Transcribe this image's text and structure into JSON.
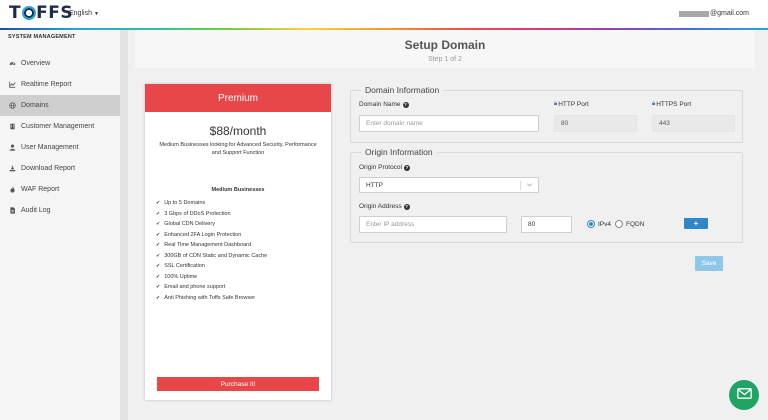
{
  "header": {
    "logo_text": "TOFFS",
    "language": "English",
    "user_email": "@gmail.com"
  },
  "sidebar": {
    "section_title": "SYSTEM MANAGEMENT",
    "items": [
      {
        "label": "Overview",
        "icon": "dashboard-icon"
      },
      {
        "label": "Realtime Report",
        "icon": "chart-icon"
      },
      {
        "label": "Domains",
        "icon": "globe-icon",
        "active": true
      },
      {
        "label": "Customer Management",
        "icon": "building-icon"
      },
      {
        "label": "User Management",
        "icon": "user-icon"
      },
      {
        "label": "Download Report",
        "icon": "download-icon"
      },
      {
        "label": "WAF Report",
        "icon": "fire-icon"
      },
      {
        "label": "Audit Log",
        "icon": "document-icon"
      }
    ]
  },
  "page": {
    "title": "Setup Domain",
    "step": "Step 1 of 2"
  },
  "plan": {
    "name": "Premium",
    "price": "$88/month",
    "description": "Medium Businesses looking for Advanced Security, Performance and Support Function",
    "subtitle": "Medium Businesses",
    "features": [
      "Up to 5 Domains",
      "3 Gbps of DDoS Protection",
      "Global CDN Delivery",
      "Enhanced 2FA Login Protection",
      "Real Time Management Dashboard",
      "300GB of CDN Static and Dynamic Cache",
      "SSL Certification",
      "100% Uptime",
      "Email and phone support",
      "Anti Phishing with Toffs Safe Browser"
    ],
    "purchase_label": "Purchase It!"
  },
  "domain_info": {
    "legend": "Domain Information",
    "domain_name_label": "Domain Name",
    "domain_name_placeholder": "Enter domain name",
    "http_port_label": "HTTP Port",
    "http_port_value": "80",
    "https_port_label": "HTTPS Port",
    "https_port_value": "443"
  },
  "origin_info": {
    "legend": "Origin Information",
    "protocol_label": "Origin Protocol",
    "protocol_value": "HTTP",
    "address_label": "Origin Address",
    "address_placeholder": "Enter IP address",
    "port_value": "80",
    "ipv4_label": "IPv4",
    "fqdn_label": "FQDN",
    "selected": "IPv4",
    "add_label": "+"
  },
  "save_label": "Save",
  "colors": {
    "accent_red": "#e8474a",
    "primary_blue": "#2f86c9",
    "save_blue": "#8ec8e8",
    "chat_green": "#1fa463"
  }
}
